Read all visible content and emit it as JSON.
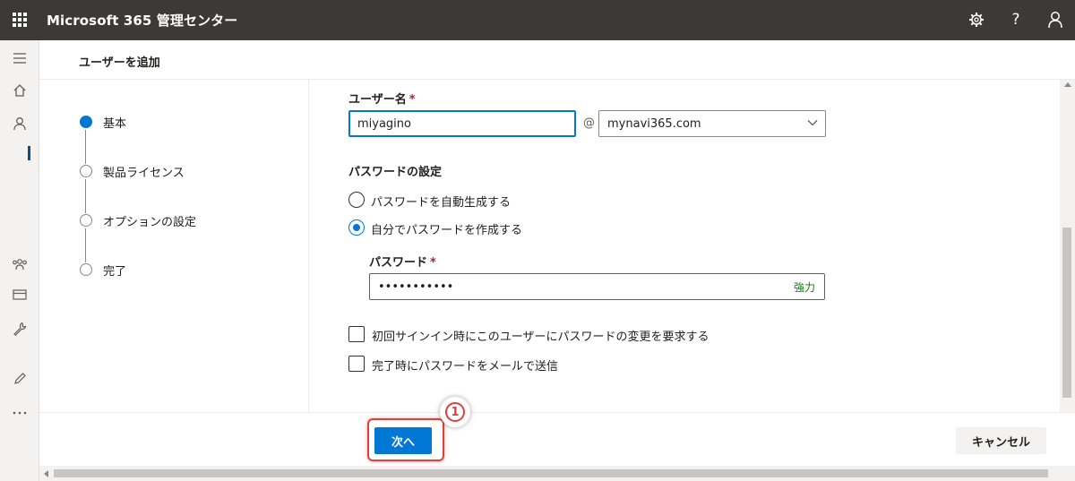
{
  "app": {
    "title": "Microsoft 365 管理センター"
  },
  "topbar": {
    "icons": [
      "waffle-icon",
      "gear-icon",
      "help-icon",
      "person-icon"
    ],
    "help_glyph": "?"
  },
  "rail": {
    "icons": [
      "hamburger-icon",
      "home-icon",
      "user-icon",
      "teams-icon",
      "billing-icon",
      "wrench-icon",
      "pencil-icon",
      "more-icon"
    ]
  },
  "panel": {
    "title": "ユーザーを追加"
  },
  "steps": [
    {
      "label": "基本",
      "active": true
    },
    {
      "label": "製品ライセンス",
      "active": false
    },
    {
      "label": "オプションの設定",
      "active": false
    },
    {
      "label": "完了",
      "active": false
    }
  ],
  "form": {
    "username_label": "ユーザー名",
    "required_mark": "*",
    "username_value": "miyagino",
    "at_symbol": "@",
    "domain_value": "mynavi365.com",
    "password_section_title": "パスワードの設定",
    "radio_auto_label": "パスワードを自動生成する",
    "radio_manual_label": "自分でパスワードを作成する",
    "selected_option": "manual",
    "password_label": "パスワード",
    "password_value": "•••••••••••",
    "password_strength": "強力",
    "checkbox_change_label": "初回サインイン時にこのユーザーにパスワードの変更を要求する",
    "checkbox_change_checked": false,
    "checkbox_email_label": "完了時にパスワードをメールで送信",
    "checkbox_email_checked": false
  },
  "footer": {
    "next_label": "次へ",
    "cancel_label": "キャンセル"
  },
  "annotation": {
    "number": "1",
    "color": "#e0403b"
  },
  "colors": {
    "accent": "#0078d4",
    "topbar": "#3b3a39",
    "strength_green": "#107c10"
  }
}
